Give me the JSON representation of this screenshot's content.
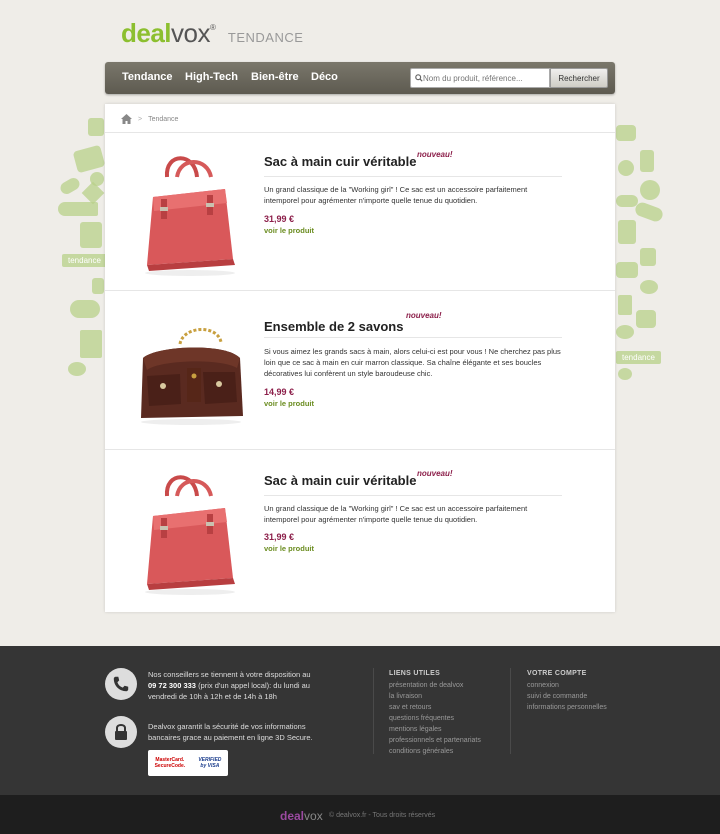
{
  "header": {
    "logo_deal": "deal",
    "logo_vox": "vox",
    "logo_reg": "®",
    "section": "TENDANCE"
  },
  "nav": {
    "items": [
      "Tendance",
      "High-Tech",
      "Bien-être",
      "Déco"
    ],
    "search_placeholder": "Nom du produit, référence...",
    "search_button": "Rechercher"
  },
  "decor": {
    "left_label": "tendance",
    "right_label": "tendance"
  },
  "breadcrumb": {
    "separator": ">",
    "current": "Tendance"
  },
  "products": [
    {
      "title": "Sac à main cuir véritable",
      "badge": "nouveau!",
      "description": "Un grand classique de la \"Working girl\" ! Ce sac est un accessoire parfaitement intemporel pour agrémenter n'importe quelle tenue du quotidien.",
      "price": "31,99 €",
      "link": "voir le produit",
      "image": "red-handbag"
    },
    {
      "title": "Ensemble de 2 savons",
      "badge": "nouveau!",
      "description": "Si vous aimez les grands sacs à main, alors celui-ci est pour vous ! Ne cherchez pas plus loin que ce sac à main en cuir marron classique. Sa chaîne élégante et ses boucles décoratives lui confèrent un style baroudeuse chic.",
      "price": "14,99 €",
      "link": "voir le produit",
      "image": "brown-handbag"
    },
    {
      "title": "Sac à main cuir véritable",
      "badge": "nouveau!",
      "description": "Un grand classique de la \"Working girl\" ! Ce sac est un accessoire parfaitement intemporel pour agrémenter n'importe quelle tenue du quotidien.",
      "price": "31,99 €",
      "link": "voir le produit",
      "image": "red-handbag"
    }
  ],
  "footer": {
    "phone_text_1": "Nos conseillers se tiennent à votre disposition au",
    "phone_number": "09 72 300 333",
    "phone_text_2": "(prix d'un appel local): du lundi au",
    "phone_text_3": "vendredi de 10h à 12h et de 14h à 18h",
    "secure_text_1": "Dealvox garantit la sécurité de vos informations",
    "secure_text_2": "bancaires grace au paiement en ligne 3D Secure.",
    "mastercard_1": "MasterCard.",
    "mastercard_2": "SecureCode.",
    "visa_1": "VERIFIED",
    "visa_2": "by VISA",
    "useful_title": "LIENS UTILES",
    "useful_links": [
      "présentation de dealvox",
      "la livraison",
      "sav et retours",
      "questions fréquentes",
      "mentions légales",
      "professionnels et partenariats",
      "conditions générales"
    ],
    "account_title": "VOTRE COMPTE",
    "account_links": [
      "connexion",
      "suivi de commande",
      "informations personnelles"
    ],
    "bottom_logo_deal": "deal",
    "bottom_logo_vox": "vox",
    "copyright": "© dealvox.fr - Tous droits réservés"
  },
  "colors": {
    "brand_green": "#8cbf2f",
    "accent_purple": "#8c1f4a",
    "link_green": "#6a8c1f"
  }
}
